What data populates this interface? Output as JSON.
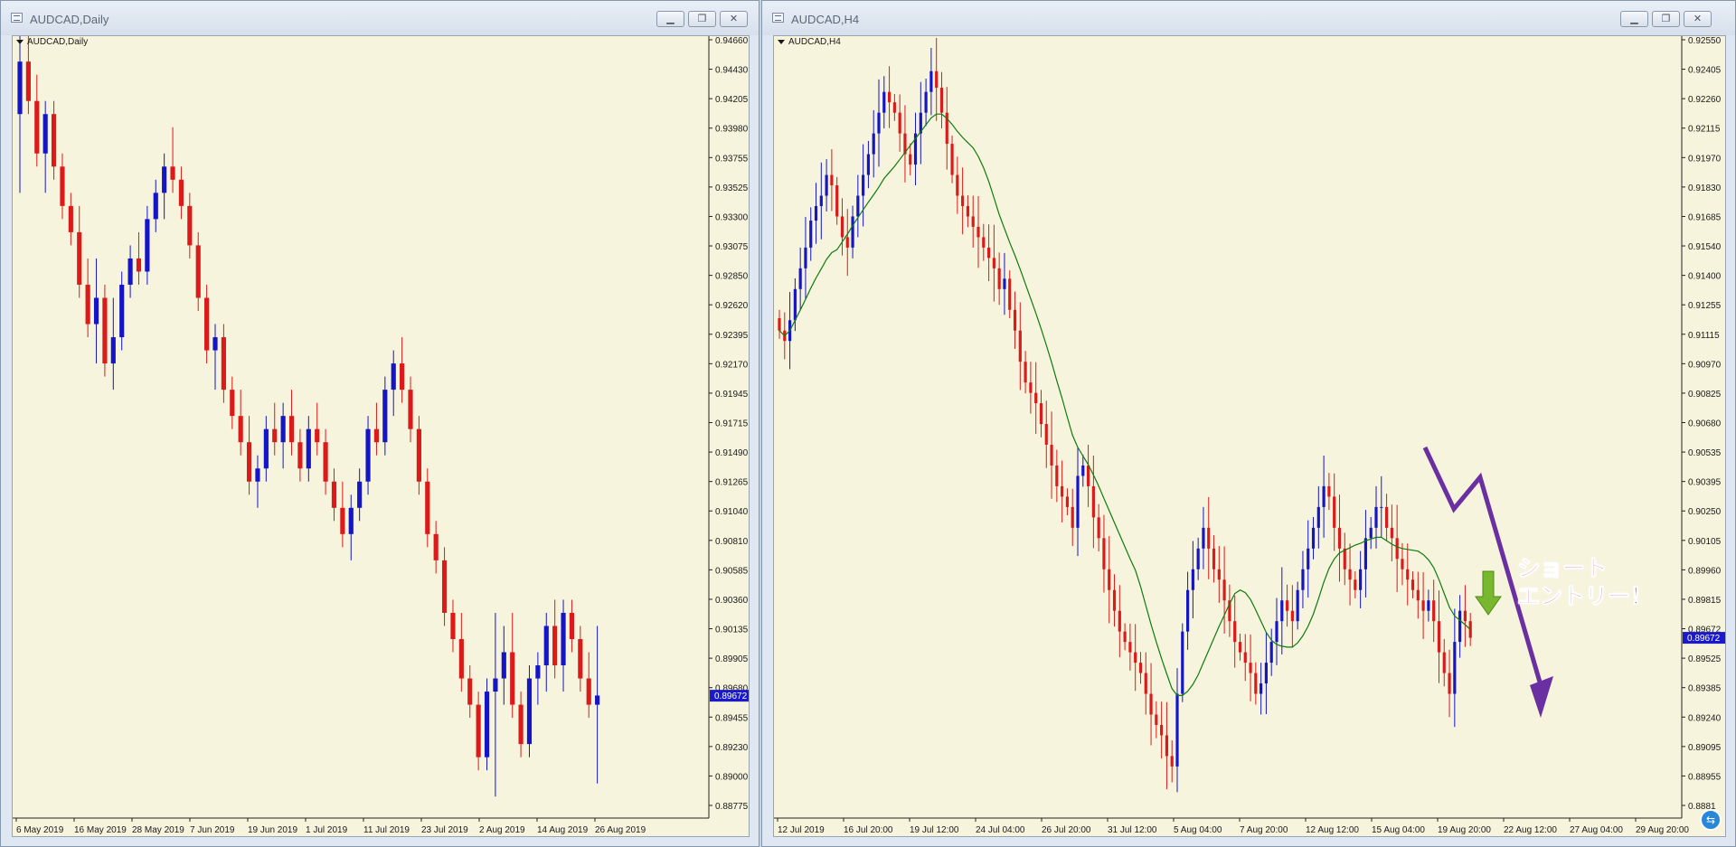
{
  "windows": [
    {
      "id": "daily",
      "title": "AUDCAD,Daily",
      "label": "AUDCAD,Daily",
      "window_controls": [
        "▁",
        "❐",
        "✕"
      ],
      "current_price": "0.89672"
    },
    {
      "id": "h4",
      "title": "AUDCAD,H4",
      "label": "AUDCAD,H4",
      "window_controls": [
        "▁",
        "❐",
        "✕"
      ],
      "current_price": "0.89672",
      "annotation": {
        "line1": "ショート",
        "line2": "エントリー！"
      }
    }
  ],
  "colors": {
    "bull": "#1515c8",
    "bear": "#dc1a1a",
    "ma": "#0f7a0f",
    "arrow": "#6a2fa0",
    "green_arrow": "#78b72e",
    "chart_bg": "#f6f4dc",
    "price_tag": "#1a1acb"
  },
  "chart_data": [
    {
      "type": "candlestick",
      "symbol": "AUDCAD",
      "timeframe": "Daily",
      "price_axis": [
        "0.94660",
        "0.94430",
        "0.94205",
        "0.93980",
        "0.93755",
        "0.93525",
        "0.93300",
        "0.93075",
        "0.92850",
        "0.92620",
        "0.92395",
        "0.92170",
        "0.91945",
        "0.91715",
        "0.91490",
        "0.91265",
        "0.91040",
        "0.90810",
        "0.90585",
        "0.90360",
        "0.90135",
        "0.89905",
        "0.89680",
        "0.89455",
        "0.89230",
        "0.89000",
        "0.88775"
      ],
      "time_axis": [
        "6 May 2019",
        "16 May 2019",
        "28 May 2019",
        "7 Jun 2019",
        "19 Jun 2019",
        "1 Jul 2019",
        "11 Jul 2019",
        "23 Jul 2019",
        "2 Aug 2019",
        "14 Aug 2019",
        "26 Aug 2019"
      ],
      "ylim": [
        0.8875,
        0.9468
      ],
      "ohlc": [
        [
          0.941,
          0.948,
          0.935,
          0.945
        ],
        [
          0.945,
          0.947,
          0.941,
          0.942
        ],
        [
          0.942,
          0.944,
          0.937,
          0.938
        ],
        [
          0.938,
          0.942,
          0.935,
          0.941
        ],
        [
          0.941,
          0.942,
          0.936,
          0.937
        ],
        [
          0.937,
          0.938,
          0.933,
          0.934
        ],
        [
          0.934,
          0.935,
          0.931,
          0.932
        ],
        [
          0.932,
          0.934,
          0.927,
          0.928
        ],
        [
          0.928,
          0.93,
          0.924,
          0.925
        ],
        [
          0.925,
          0.93,
          0.922,
          0.927
        ],
        [
          0.927,
          0.928,
          0.921,
          0.922
        ],
        [
          0.922,
          0.927,
          0.92,
          0.924
        ],
        [
          0.924,
          0.929,
          0.923,
          0.928
        ],
        [
          0.928,
          0.931,
          0.927,
          0.93
        ],
        [
          0.93,
          0.932,
          0.928,
          0.929
        ],
        [
          0.929,
          0.934,
          0.928,
          0.933
        ],
        [
          0.933,
          0.936,
          0.932,
          0.935
        ],
        [
          0.935,
          0.938,
          0.933,
          0.937
        ],
        [
          0.937,
          0.94,
          0.935,
          0.936
        ],
        [
          0.936,
          0.937,
          0.933,
          0.934
        ],
        [
          0.934,
          0.935,
          0.93,
          0.931
        ],
        [
          0.931,
          0.932,
          0.926,
          0.927
        ],
        [
          0.927,
          0.928,
          0.922,
          0.923
        ],
        [
          0.923,
          0.925,
          0.92,
          0.924
        ],
        [
          0.924,
          0.925,
          0.919,
          0.92
        ],
        [
          0.92,
          0.921,
          0.917,
          0.918
        ],
        [
          0.918,
          0.92,
          0.915,
          0.916
        ],
        [
          0.916,
          0.918,
          0.912,
          0.913
        ],
        [
          0.913,
          0.915,
          0.911,
          0.914
        ],
        [
          0.914,
          0.918,
          0.913,
          0.917
        ],
        [
          0.917,
          0.919,
          0.915,
          0.916
        ],
        [
          0.916,
          0.919,
          0.914,
          0.918
        ],
        [
          0.918,
          0.92,
          0.915,
          0.916
        ],
        [
          0.916,
          0.917,
          0.913,
          0.914
        ],
        [
          0.914,
          0.918,
          0.913,
          0.917
        ],
        [
          0.917,
          0.919,
          0.915,
          0.916
        ],
        [
          0.916,
          0.917,
          0.912,
          0.913
        ],
        [
          0.913,
          0.914,
          0.91,
          0.911
        ],
        [
          0.911,
          0.913,
          0.908,
          0.909
        ],
        [
          0.909,
          0.912,
          0.907,
          0.911
        ],
        [
          0.911,
          0.914,
          0.91,
          0.913
        ],
        [
          0.913,
          0.918,
          0.912,
          0.917
        ],
        [
          0.917,
          0.919,
          0.915,
          0.916
        ],
        [
          0.916,
          0.921,
          0.915,
          0.92
        ],
        [
          0.92,
          0.923,
          0.918,
          0.922
        ],
        [
          0.922,
          0.924,
          0.919,
          0.92
        ],
        [
          0.92,
          0.921,
          0.916,
          0.917
        ],
        [
          0.917,
          0.918,
          0.912,
          0.913
        ],
        [
          0.913,
          0.914,
          0.908,
          0.909
        ],
        [
          0.909,
          0.91,
          0.906,
          0.907
        ],
        [
          0.907,
          0.908,
          0.902,
          0.903
        ],
        [
          0.903,
          0.904,
          0.9,
          0.901
        ],
        [
          0.901,
          0.903,
          0.897,
          0.898
        ],
        [
          0.898,
          0.899,
          0.895,
          0.896
        ],
        [
          0.896,
          0.897,
          0.891,
          0.892
        ],
        [
          0.892,
          0.898,
          0.891,
          0.897
        ],
        [
          0.897,
          0.903,
          0.889,
          0.898
        ],
        [
          0.898,
          0.902,
          0.896,
          0.9
        ],
        [
          0.9,
          0.903,
          0.895,
          0.896
        ],
        [
          0.896,
          0.897,
          0.892,
          0.893
        ],
        [
          0.893,
          0.899,
          0.892,
          0.898
        ],
        [
          0.898,
          0.9,
          0.896,
          0.899
        ],
        [
          0.899,
          0.903,
          0.897,
          0.902
        ],
        [
          0.902,
          0.904,
          0.898,
          0.899
        ],
        [
          0.899,
          0.904,
          0.897,
          0.903
        ],
        [
          0.903,
          0.904,
          0.9,
          0.901
        ],
        [
          0.901,
          0.902,
          0.897,
          0.898
        ],
        [
          0.898,
          0.9,
          0.895,
          0.896
        ],
        [
          0.896,
          0.902,
          0.89,
          0.8967
        ]
      ]
    },
    {
      "type": "candlestick",
      "symbol": "AUDCAD",
      "timeframe": "H4",
      "overlay": "moving-average",
      "price_axis": [
        "0.92550",
        "0.92405",
        "0.92260",
        "0.92115",
        "0.91970",
        "0.91830",
        "0.91685",
        "0.91540",
        "0.91400",
        "0.91255",
        "0.91115",
        "0.90970",
        "0.90825",
        "0.90680",
        "0.90535",
        "0.90395",
        "0.90250",
        "0.90105",
        "0.89960",
        "0.89815",
        "0.89672",
        "0.89525",
        "0.89385",
        "0.89240",
        "0.89095",
        "0.88955",
        "0.8881"
      ],
      "time_axis": [
        "12 Jul 2019",
        "16 Jul 20:00",
        "19 Jul 12:00",
        "24 Jul 04:00",
        "26 Jul 20:00",
        "31 Jul 12:00",
        "5 Aug 04:00",
        "7 Aug 20:00",
        "12 Aug 12:00",
        "15 Aug 04:00",
        "19 Aug 20:00",
        "22 Aug 12:00",
        "27 Aug 04:00",
        "29 Aug 20:00"
      ],
      "ylim": [
        0.8881,
        0.9256
      ],
      "closes": [
        0.9115,
        0.911,
        0.912,
        0.9135,
        0.9145,
        0.9155,
        0.9168,
        0.9175,
        0.918,
        0.919,
        0.9185,
        0.917,
        0.916,
        0.9155,
        0.917,
        0.918,
        0.919,
        0.92,
        0.921,
        0.922,
        0.923,
        0.9225,
        0.922,
        0.921,
        0.92,
        0.9195,
        0.921,
        0.922,
        0.923,
        0.924,
        0.9232,
        0.922,
        0.9205,
        0.919,
        0.918,
        0.9175,
        0.917,
        0.9165,
        0.916,
        0.9155,
        0.915,
        0.9145,
        0.9135,
        0.914,
        0.9125,
        0.9115,
        0.91,
        0.909,
        0.9085,
        0.908,
        0.907,
        0.906,
        0.905,
        0.904,
        0.9035,
        0.903,
        0.902,
        0.9045,
        0.905,
        0.904,
        0.9025,
        0.9015,
        0.9,
        0.899,
        0.898,
        0.897,
        0.8965,
        0.896,
        0.8955,
        0.895,
        0.894,
        0.893,
        0.8925,
        0.892,
        0.891,
        0.8905,
        0.894,
        0.897,
        0.899,
        0.9,
        0.901,
        0.902,
        0.901,
        0.9,
        0.8995,
        0.8985,
        0.8975,
        0.8965,
        0.896,
        0.8955,
        0.895,
        0.894,
        0.8945,
        0.8955,
        0.8965,
        0.8975,
        0.8985,
        0.898,
        0.8975,
        0.899,
        0.9,
        0.901,
        0.902,
        0.903,
        0.904,
        0.9035,
        0.902,
        0.901,
        0.9,
        0.8995,
        0.899,
        0.9,
        0.9015,
        0.902,
        0.903,
        0.903,
        0.902,
        0.9015,
        0.9005,
        0.9,
        0.8995,
        0.899,
        0.8985,
        0.898,
        0.8985,
        0.8975,
        0.896,
        0.895,
        0.894,
        0.8965,
        0.898,
        0.8975,
        0.8967
      ]
    }
  ]
}
